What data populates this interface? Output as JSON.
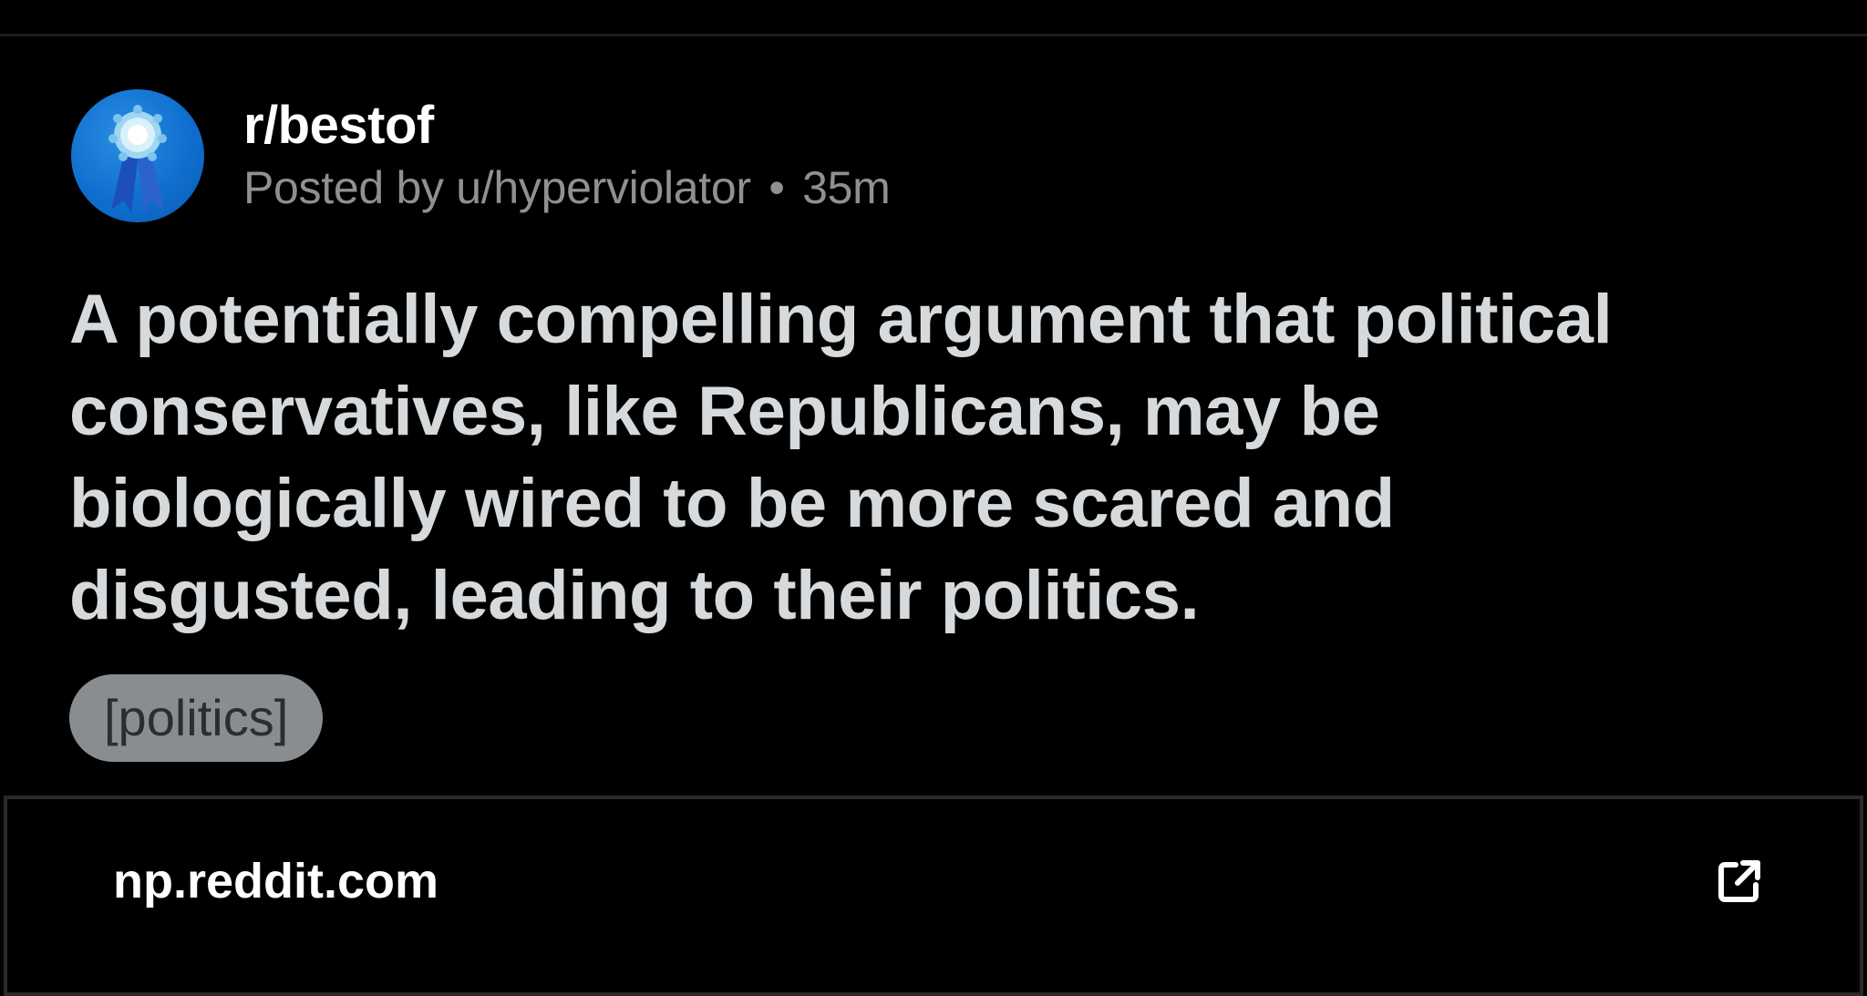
{
  "post": {
    "subreddit": "r/bestof",
    "posted_by_prefix": "Posted by",
    "author": "u/hyperviolator",
    "dot": "•",
    "age": "35m",
    "title": "A potentially compelling argument that political conservatives, like Republicans, may be biologically wired to be more scared and disgusted, leading to their politics.",
    "flair": "[politics]"
  },
  "link": {
    "domain": "np.reddit.com",
    "icon": "external-link-icon"
  },
  "colors": {
    "background": "#000000",
    "title_text": "#d7dadc",
    "meta_text": "#8e9194",
    "flair_bg": "#8a8d90",
    "avatar_blue": "#0f6fcf"
  },
  "icons": {
    "avatar": "ribbon-award-avatar"
  }
}
